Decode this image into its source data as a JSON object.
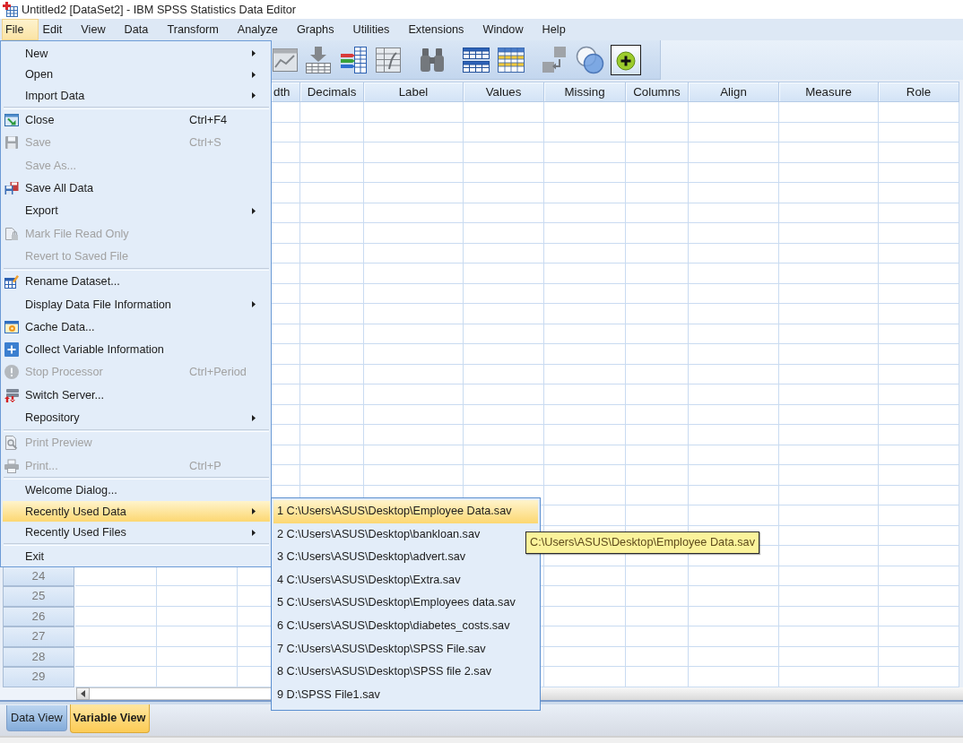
{
  "window": {
    "title": "Untitled2 [DataSet2] - IBM SPSS Statistics Data Editor"
  },
  "menu_bar": [
    {
      "label": "File",
      "selected": true
    },
    {
      "label": "Edit",
      "selected": false
    },
    {
      "label": "View",
      "selected": false
    },
    {
      "label": "Data",
      "selected": false
    },
    {
      "label": "Transform",
      "selected": false
    },
    {
      "label": "Analyze",
      "selected": false
    },
    {
      "label": "Graphs",
      "selected": false
    },
    {
      "label": "Utilities",
      "selected": false
    },
    {
      "label": "Extensions",
      "selected": false
    },
    {
      "label": "Window",
      "selected": false
    },
    {
      "label": "Help",
      "selected": false
    }
  ],
  "toolbar": {
    "groups": [
      {
        "buttons": [
          {
            "disabled": true,
            "highlighted": false
          },
          {
            "disabled": true,
            "highlighted": false
          },
          {
            "disabled": false,
            "highlighted": false
          },
          {
            "disabled": true,
            "highlighted": false
          }
        ]
      },
      {
        "buttons": [
          {
            "disabled": true,
            "highlighted": false
          }
        ]
      },
      {
        "buttons": [
          {
            "disabled": false,
            "highlighted": false
          },
          {
            "disabled": false,
            "highlighted": false
          }
        ]
      },
      {
        "buttons": [
          {
            "disabled": true,
            "highlighted": false
          },
          {
            "disabled": false,
            "highlighted": false
          },
          {
            "disabled": false,
            "highlighted": true
          }
        ]
      }
    ]
  },
  "grid": {
    "columns": [
      "dth",
      "Decimals",
      "Label",
      "Values",
      "Missing",
      "Columns",
      "Align",
      "Measure",
      "Role"
    ],
    "row_numbers": [
      "24",
      "25",
      "26",
      "27",
      "28",
      "29"
    ]
  },
  "tabs": [
    {
      "label": "Data View",
      "selected": false
    },
    {
      "label": "Variable View",
      "selected": true
    }
  ],
  "file_menu": {
    "sections": [
      {
        "items": [
          {
            "label": "New",
            "submenu": true,
            "disabled": false,
            "selected": false
          },
          {
            "label": "Open",
            "submenu": true,
            "disabled": false,
            "selected": false
          },
          {
            "label": "Import Data",
            "submenu": true,
            "disabled": false,
            "selected": false
          }
        ]
      },
      {
        "items": [
          {
            "label": "Close",
            "shortcut": "Ctrl+F4",
            "submenu": false,
            "disabled": false,
            "selected": false
          },
          {
            "label": "Save",
            "shortcut": "Ctrl+S",
            "submenu": false,
            "disabled": true,
            "selected": false
          },
          {
            "label": "Save As...",
            "submenu": false,
            "disabled": true,
            "selected": false
          },
          {
            "label": "Save All Data",
            "submenu": false,
            "disabled": false,
            "selected": false
          },
          {
            "label": "Export",
            "submenu": true,
            "disabled": false,
            "selected": false
          },
          {
            "label": "Mark File Read Only",
            "submenu": false,
            "disabled": true,
            "selected": false
          },
          {
            "label": "Revert to Saved File",
            "submenu": false,
            "disabled": true,
            "selected": false
          }
        ]
      },
      {
        "items": [
          {
            "label": "Rename Dataset...",
            "submenu": false,
            "disabled": false,
            "selected": false
          },
          {
            "label": "Display Data File Information",
            "submenu": true,
            "disabled": false,
            "selected": false
          },
          {
            "label": "Cache Data...",
            "submenu": false,
            "disabled": false,
            "selected": false
          },
          {
            "label": "Collect Variable Information",
            "submenu": false,
            "disabled": false,
            "selected": false
          },
          {
            "label": "Stop Processor",
            "shortcut": "Ctrl+Period",
            "submenu": false,
            "disabled": true,
            "selected": false
          },
          {
            "label": "Switch Server...",
            "submenu": false,
            "disabled": false,
            "selected": false
          },
          {
            "label": "Repository",
            "submenu": true,
            "disabled": false,
            "selected": false
          }
        ]
      },
      {
        "items": [
          {
            "label": "Print Preview",
            "submenu": false,
            "disabled": true,
            "selected": false
          },
          {
            "label": "Print...",
            "shortcut": "Ctrl+P",
            "submenu": false,
            "disabled": true,
            "selected": false
          }
        ]
      },
      {
        "items": [
          {
            "label": "Welcome Dialog...",
            "submenu": false,
            "disabled": false,
            "selected": false
          },
          {
            "label": "Recently Used Data",
            "submenu": true,
            "disabled": false,
            "selected": true
          },
          {
            "label": "Recently Used Files",
            "submenu": true,
            "disabled": false,
            "selected": false
          }
        ]
      },
      {
        "items": [
          {
            "label": "Exit",
            "submenu": false,
            "disabled": false,
            "selected": false
          }
        ]
      }
    ]
  },
  "recent_data_menu": {
    "items": [
      {
        "label": "1 C:\\Users\\ASUS\\Desktop\\Employee Data.sav",
        "selected": true
      },
      {
        "label": "2 C:\\Users\\ASUS\\Desktop\\bankloan.sav",
        "selected": false
      },
      {
        "label": "3 C:\\Users\\ASUS\\Desktop\\advert.sav",
        "selected": false
      },
      {
        "label": "4 C:\\Users\\ASUS\\Desktop\\Extra.sav",
        "selected": false
      },
      {
        "label": "5 C:\\Users\\ASUS\\Desktop\\Employees data.sav",
        "selected": false
      },
      {
        "label": "6 C:\\Users\\ASUS\\Desktop\\diabetes_costs.sav",
        "selected": false
      },
      {
        "label": "7 C:\\Users\\ASUS\\Desktop\\SPSS File.sav",
        "selected": false
      },
      {
        "label": "8 C:\\Users\\ASUS\\Desktop\\SPSS file 2.sav",
        "selected": false
      },
      {
        "label": "9 D:\\SPSS File1.sav",
        "selected": false
      }
    ]
  },
  "tooltip": {
    "text": "C:\\Users\\ASUS\\Desktop\\Employee Data.sav"
  }
}
